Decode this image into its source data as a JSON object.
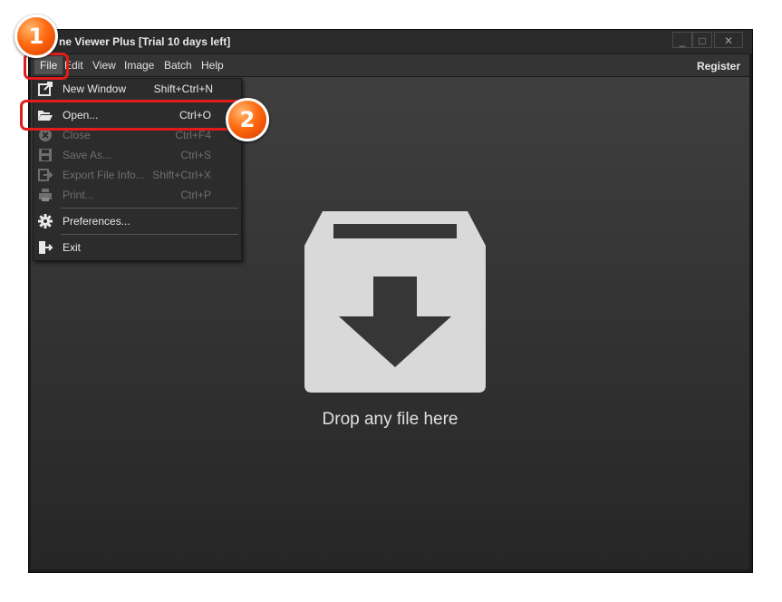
{
  "window": {
    "title": "ne Viewer Plus [Trial 10 days left]",
    "controls": {
      "minimize": "_",
      "maximize": "□",
      "close": "✕"
    }
  },
  "menubar": {
    "items": [
      "File",
      "Edit",
      "View",
      "Image",
      "Batch",
      "Help"
    ],
    "register": "Register"
  },
  "file_menu": {
    "items": [
      {
        "label": "New Window",
        "shortcut": "Shift+Ctrl+N",
        "icon": "new-window-icon",
        "enabled": true
      },
      {
        "label": "Open...",
        "shortcut": "Ctrl+O",
        "icon": "folder-open-icon",
        "enabled": true
      },
      {
        "label": "Close",
        "shortcut": "Ctrl+F4",
        "icon": "close-circle-icon",
        "enabled": false
      },
      {
        "label": "Save As...",
        "shortcut": "Ctrl+S",
        "icon": "save-icon",
        "enabled": false
      },
      {
        "label": "Export File Info...",
        "shortcut": "Shift+Ctrl+X",
        "icon": "export-icon",
        "enabled": false
      },
      {
        "label": "Print...",
        "shortcut": "Ctrl+P",
        "icon": "printer-icon",
        "enabled": false
      },
      {
        "label": "Preferences...",
        "shortcut": "",
        "icon": "gear-icon",
        "enabled": true
      },
      {
        "label": "Exit",
        "shortcut": "",
        "icon": "exit-icon",
        "enabled": true
      }
    ]
  },
  "main": {
    "drop_text": "Drop any file here",
    "drop_icon": "download-box-icon"
  },
  "annotations": {
    "step1": "1",
    "step2": "2",
    "highlight_color": "#e21b1b",
    "badge_color": "#ff6a10"
  }
}
